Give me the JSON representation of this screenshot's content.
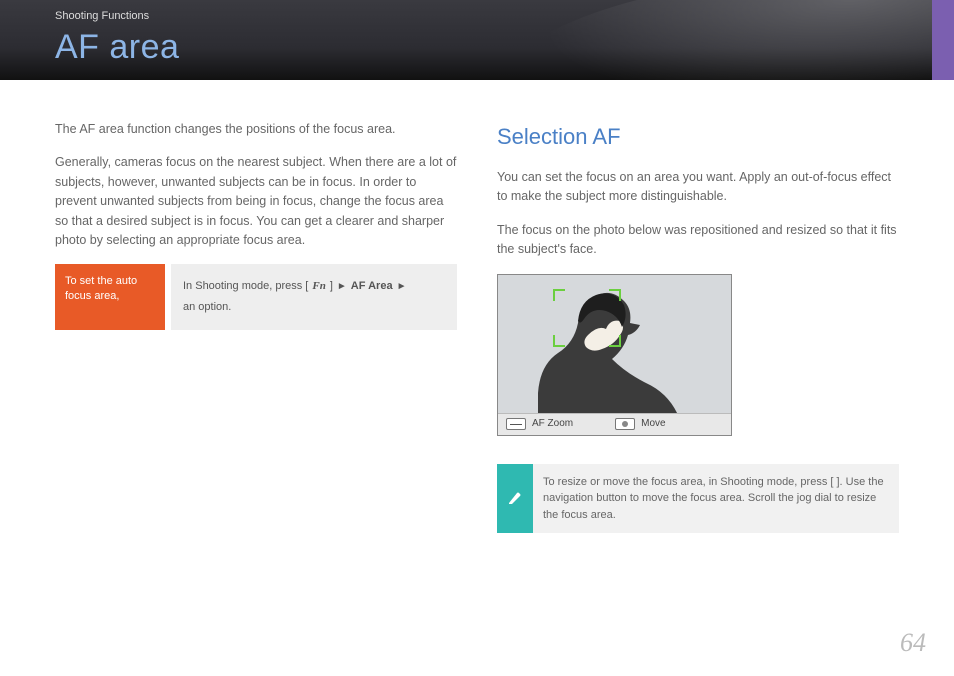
{
  "header": {
    "section": "Shooting Functions",
    "title": "AF area"
  },
  "left": {
    "p1": "The AF area function changes the positions of the focus area.",
    "p2": "Generally, cameras focus on the nearest subject. When there are a lot of subjects, however, unwanted subjects can be in focus. In order to prevent unwanted subjects from being in focus, change the focus area so that a desired subject is in focus. You can get a clearer and sharper photo by selecting an appropriate focus area.",
    "orange": "To set the auto focus area,",
    "grey_prefix": "In Shooting mode, press [",
    "grey_fn": "Fn",
    "grey_mid1": "] ",
    "grey_arrow": "►",
    "grey_afarea": "AF Area",
    "grey_suffix": " an option."
  },
  "right": {
    "heading": "Selection AF",
    "p1": "You can set the focus on an area you want. Apply an out-of-focus effect to make the subject more distinguishable.",
    "p2": "The focus on the photo below was repositioned and resized so that it fits the subject's face.",
    "bar_zoom": "AF Zoom",
    "bar_move": "Move",
    "note": "To resize or move the focus area, in Shooting mode, press [  ]. Use the navigation button to move the focus area. Scroll the jog dial to resize the focus area."
  },
  "page_number": "64"
}
